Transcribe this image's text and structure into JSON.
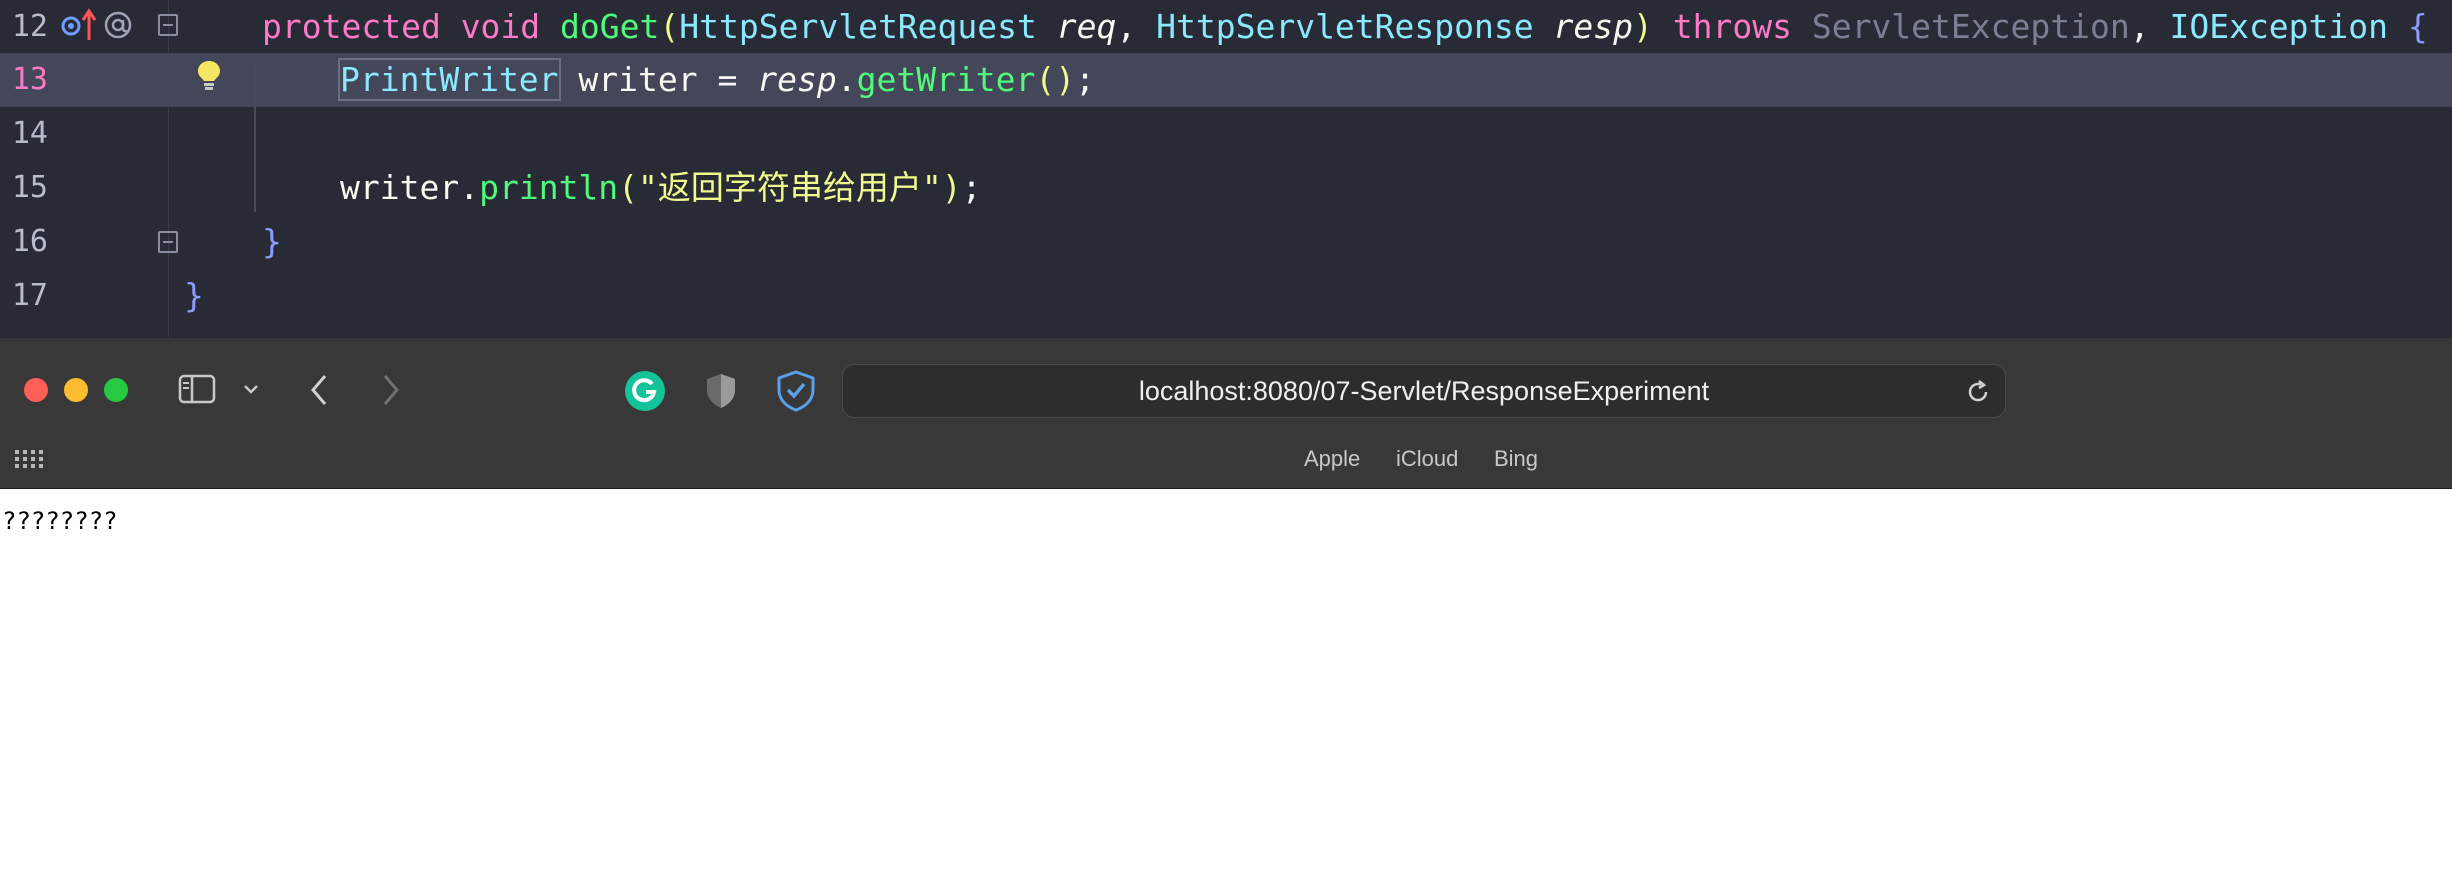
{
  "editor": {
    "lines": [
      {
        "number": "12"
      },
      {
        "number": "13"
      },
      {
        "number": "14"
      },
      {
        "number": "15"
      },
      {
        "number": "16"
      },
      {
        "number": "17"
      }
    ],
    "code": {
      "l12": {
        "protected": "protected",
        "void": "void",
        "method": "doGet",
        "open_paren": "(",
        "req_type": "HttpServletRequest",
        "req_name": "req",
        "comma1": ", ",
        "resp_type": "HttpServletResponse",
        "resp_name": "resp",
        "close_paren": ")",
        "throws": "throws",
        "exc1": "ServletException",
        "comma2": ", ",
        "exc2": "IOException",
        "brace": "{"
      },
      "l13": {
        "type": "PrintWriter",
        "var": " writer = ",
        "obj": "resp",
        "dot": ".",
        "method": "getWriter",
        "parens": "()",
        "semi": ";"
      },
      "l15": {
        "obj": "writer",
        "dot": ".",
        "method": "println",
        "open": "(",
        "string": "\"返回字符串给用户\"",
        "close": ")",
        "semi": ";"
      },
      "l16": {
        "brace": "}"
      },
      "l17": {
        "brace": "}"
      }
    },
    "gutter_icons": [
      "override-icon",
      "implementation-arrow-icon",
      "annotation-icon",
      "fold-icon",
      "intention-bulb-icon"
    ],
    "colors": {
      "background": "#282a36",
      "current_line": "#44475a",
      "keyword": "#ff79c6",
      "function": "#50fa7b",
      "type": "#8be9fd"
    }
  },
  "browser": {
    "url": "localhost:8080/07-Servlet/ResponseExperiment",
    "favorites": [
      "Apple",
      "iCloud",
      "Bing"
    ],
    "page_text": "????????",
    "icons": [
      "close-window-icon",
      "minimize-window-icon",
      "zoom-window-icon",
      "sidebar-icon",
      "chevron-down-icon",
      "back-icon",
      "forward-icon",
      "grammarly-icon",
      "privacy-shield-icon",
      "adguard-shield-icon",
      "reload-icon",
      "grid-icon"
    ]
  }
}
